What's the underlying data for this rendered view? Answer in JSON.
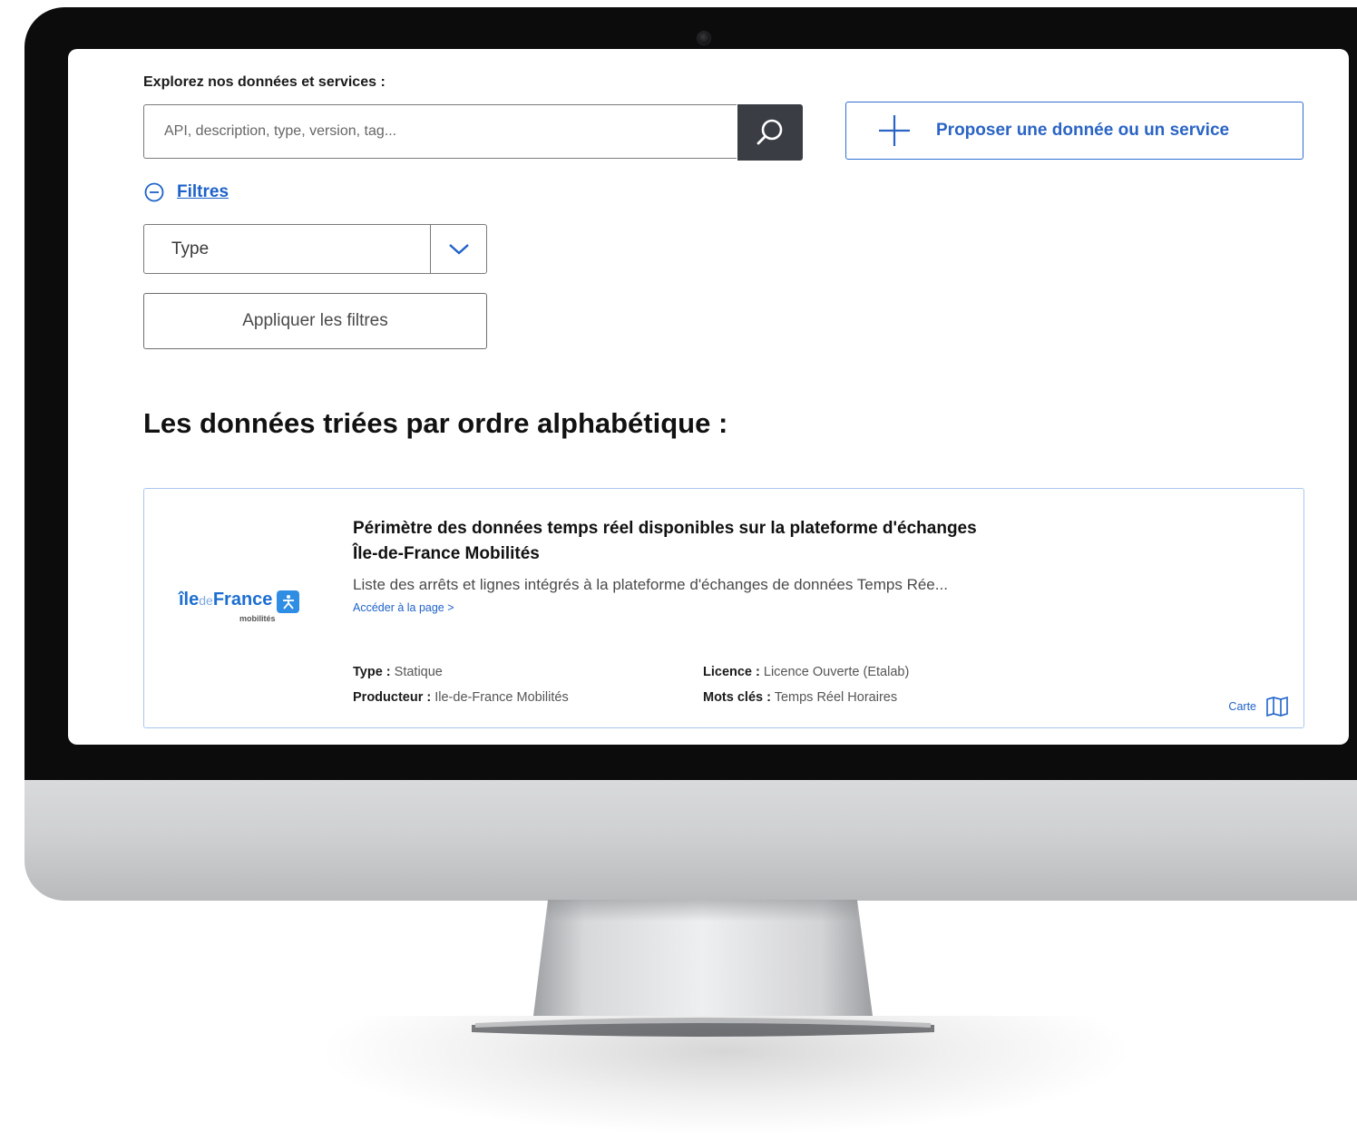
{
  "search": {
    "label": "Explorez nos données et services :",
    "placeholder": "API, description, type, version, tag..."
  },
  "actions": {
    "propose_label": "Proposer une donnée ou un service"
  },
  "filters": {
    "toggle_label": "Filtres",
    "type_select": {
      "selected": "Type"
    },
    "apply_label": "Appliquer les filtres"
  },
  "section": {
    "title": "Les données triées par ordre alphabétique :"
  },
  "results": [
    {
      "logo": {
        "name_prefix": "île",
        "name_de": "de",
        "name_main": "France",
        "subtitle": "mobilités"
      },
      "title": "Périmètre des données temps réel disponibles sur la plateforme d'échanges Île-de-France Mobilités",
      "description": "Liste des arrêts et lignes intégrés à la plateforme d'échanges de données Temps Rée...",
      "link_label": "Accéder à la page >",
      "type_label": "Type :",
      "type_value": "Statique",
      "producer_label": "Producteur :",
      "producer_value": "Ile-de-France Mobilités",
      "license_label": "Licence :",
      "license_value": "Licence Ouverte (Etalab)",
      "keywords_label": "Mots clés :",
      "keywords_value": "Temps Réel Horaires",
      "map_label": "Carte"
    }
  ],
  "colors": {
    "accent_blue": "#2a64c4",
    "search_button": "#3a3d44",
    "card_border": "#a9c7ee"
  }
}
